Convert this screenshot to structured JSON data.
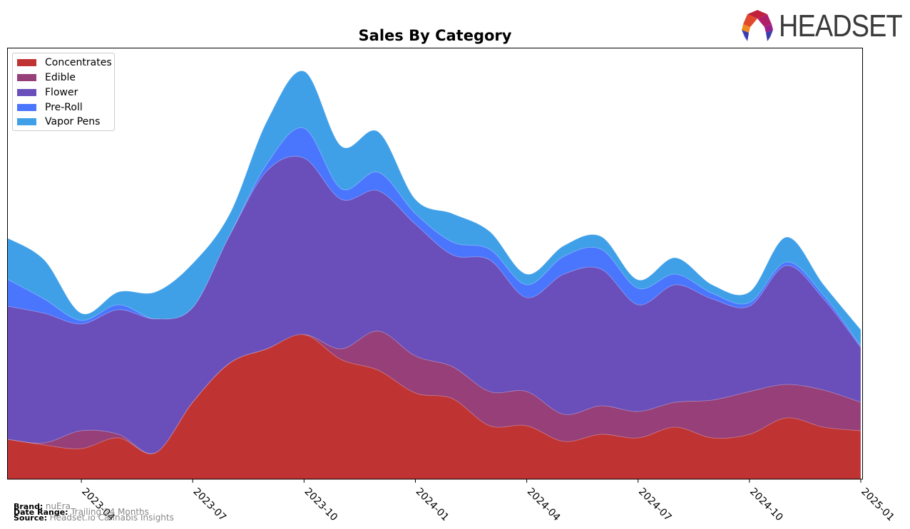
{
  "header": {
    "logo_text": "HEADSET"
  },
  "footer": {
    "brand_label": "Brand:",
    "brand_value": "nuEra",
    "date_range_label": "Date Range:",
    "date_range_value": "Trailing 24 Months",
    "source_label": "Source:",
    "source_value": "Headset.io Cannabis Insights"
  },
  "chart_data": {
    "type": "area",
    "stacked": true,
    "smoothed": true,
    "title": "Sales By Category",
    "xlabel": "",
    "ylabel": "",
    "y_axis_visible": false,
    "grid": false,
    "legend_position": "top-left",
    "x": [
      "2023-02",
      "2023-03",
      "2023-04",
      "2023-05",
      "2023-06",
      "2023-07",
      "2023-08",
      "2023-09",
      "2023-10",
      "2023-11",
      "2023-12",
      "2024-01",
      "2024-02",
      "2024-03",
      "2024-04",
      "2024-05",
      "2024-06",
      "2024-07",
      "2024-08",
      "2024-09",
      "2024-10",
      "2024-11",
      "2024-12",
      "2025-01"
    ],
    "x_ticks": [
      "2023-04",
      "2023-07",
      "2023-10",
      "2024-01",
      "2024-04",
      "2024-07",
      "2024-10",
      "2025-01"
    ],
    "series": [
      {
        "name": "Concentrates",
        "color": "#c03333",
        "values": [
          56,
          48,
          43,
          58,
          37,
          108,
          163,
          183,
          203,
          168,
          153,
          121,
          113,
          75,
          75,
          53,
          63,
          58,
          73,
          58,
          63,
          86,
          73,
          68
        ]
      },
      {
        "name": "Edible",
        "color": "#963f78",
        "values": [
          0,
          3,
          25,
          5,
          0,
          0,
          0,
          0,
          0,
          15,
          55,
          52,
          45,
          48,
          48,
          38,
          40,
          37,
          35,
          53,
          60,
          47,
          52,
          40
        ]
      },
      {
        "name": "Flower",
        "color": "#6a4fbb",
        "values": [
          187,
          182,
          150,
          175,
          188,
          133,
          180,
          250,
          248,
          210,
          197,
          185,
          157,
          185,
          132,
          197,
          192,
          150,
          165,
          142,
          120,
          167,
          128,
          77
        ]
      },
      {
        "name": "Pre-Roll",
        "color": "#4a76fe",
        "values": [
          38,
          20,
          5,
          7,
          0,
          0,
          0,
          10,
          42,
          15,
          26,
          15,
          18,
          15,
          18,
          25,
          28,
          23,
          15,
          8,
          5,
          5,
          5,
          2
        ]
      },
      {
        "name": "Vapor Pens",
        "color": "#3fa0e8",
        "values": [
          58,
          55,
          10,
          18,
          38,
          62,
          30,
          60,
          80,
          60,
          57,
          20,
          40,
          25,
          15,
          15,
          18,
          12,
          23,
          12,
          15,
          35,
          15,
          23
        ]
      }
    ]
  }
}
